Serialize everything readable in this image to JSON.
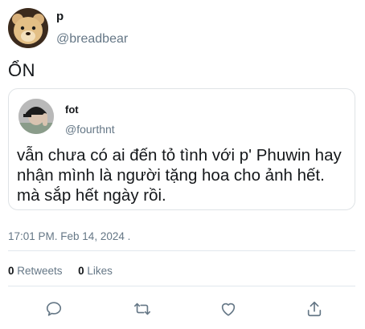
{
  "tweet": {
    "author": {
      "display_name": "p",
      "handle": "@breadbear",
      "avatar_icon": "bear-plush-avatar"
    },
    "text": "ỔN",
    "quoted_tweet": {
      "author": {
        "display_name": "fot",
        "handle": "@fourthnt",
        "avatar_icon": "person-cap-avatar"
      },
      "text": "vẫn chưa có ai đến tỏ tình với p' Phuwin hay nhận mình là người tặng hoa cho ảnh hết. mà sắp hết ngày rồi."
    },
    "timestamp": "17:01 PM. Feb 14, 2024  .",
    "stats": {
      "retweets_count": "0",
      "retweets_label": "Retweets",
      "likes_count": "0",
      "likes_label": "Likes"
    },
    "actions": [
      "reply-icon",
      "retweet-icon",
      "like-icon",
      "share-icon"
    ]
  },
  "colors": {
    "text_primary": "#14171a",
    "text_secondary": "#657786",
    "border": "#dfe3e6"
  }
}
